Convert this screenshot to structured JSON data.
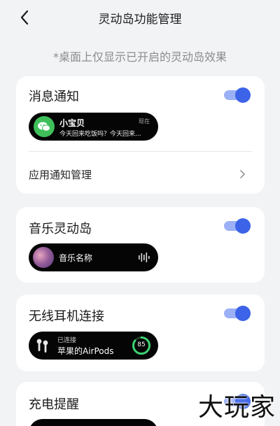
{
  "header": {
    "title": "灵动岛功能管理"
  },
  "hint": "*桌面上仅显示已开启的灵动岛效果",
  "cards": {
    "message": {
      "title": "消息通知",
      "enabled": true,
      "preview": {
        "icon": "wechat-icon",
        "sender": "小宝贝",
        "time": "现在",
        "message": "今天回来吃饭吗？今天回来..."
      },
      "row_label": "应用通知管理"
    },
    "music": {
      "title": "音乐灵动岛",
      "enabled": true,
      "preview": {
        "icon": "album-cover-icon",
        "song": "音乐名称",
        "wave_icon": "waveform-icon"
      }
    },
    "earbuds": {
      "title": "无线耳机连接",
      "enabled": true,
      "preview": {
        "icon": "airpods-icon",
        "status": "已连接",
        "device": "苹果的AirPods",
        "battery": "85",
        "battery_fraction": 0.85
      }
    },
    "charging": {
      "title": "充电提醒",
      "enabled": true
    }
  },
  "colors": {
    "accent": "#3c63e8",
    "toggle_track": "#9bb0f5",
    "wechat_green": "#3fbf5a",
    "battery_green": "#3cd070"
  },
  "watermark": "大玩家"
}
